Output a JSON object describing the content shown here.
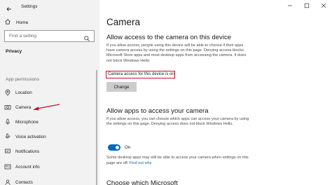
{
  "window": {
    "title": "Settings",
    "controls": [
      "minimize",
      "maximize",
      "close"
    ]
  },
  "sidebar": {
    "home_label": "Home",
    "search_placeholder": "Find a setting",
    "section_title": "Privacy",
    "group_label": "App permissions",
    "items": [
      {
        "label": "Location",
        "icon": "location-icon"
      },
      {
        "label": "Camera",
        "icon": "camera-icon",
        "selected": true
      },
      {
        "label": "Microphone",
        "icon": "microphone-icon"
      },
      {
        "label": "Voice activation",
        "icon": "voice-activation-icon"
      },
      {
        "label": "Notifications",
        "icon": "notifications-icon"
      },
      {
        "label": "Account info",
        "icon": "account-info-icon"
      },
      {
        "label": "Contacts",
        "icon": "contacts-icon"
      }
    ]
  },
  "main": {
    "title": "Camera",
    "section1": {
      "heading": "Allow access to the camera on this device",
      "description": "If you allow access, people using this device will be able to choose if their apps have camera access by using the settings on this page. Denying access blocks Microsoft Store apps and most desktop apps from accessing the camera. It does not block Windows Hello.",
      "status": "Camera access for this device is on",
      "change_button": "Change"
    },
    "section2": {
      "heading": "Allow apps to access your camera",
      "description": "If you allow access, you can choose which apps can access your camera by using the settings on this page. Denying access does not block Windows Hello.",
      "toggle_state": "On",
      "note": "Some desktop apps may still be able to access your camera when settings on this page are off.",
      "link": "Find out why"
    },
    "next_heading": "Choose which Microsoft"
  },
  "colors": {
    "accent": "#0067c0",
    "highlight": "#c8102e"
  }
}
